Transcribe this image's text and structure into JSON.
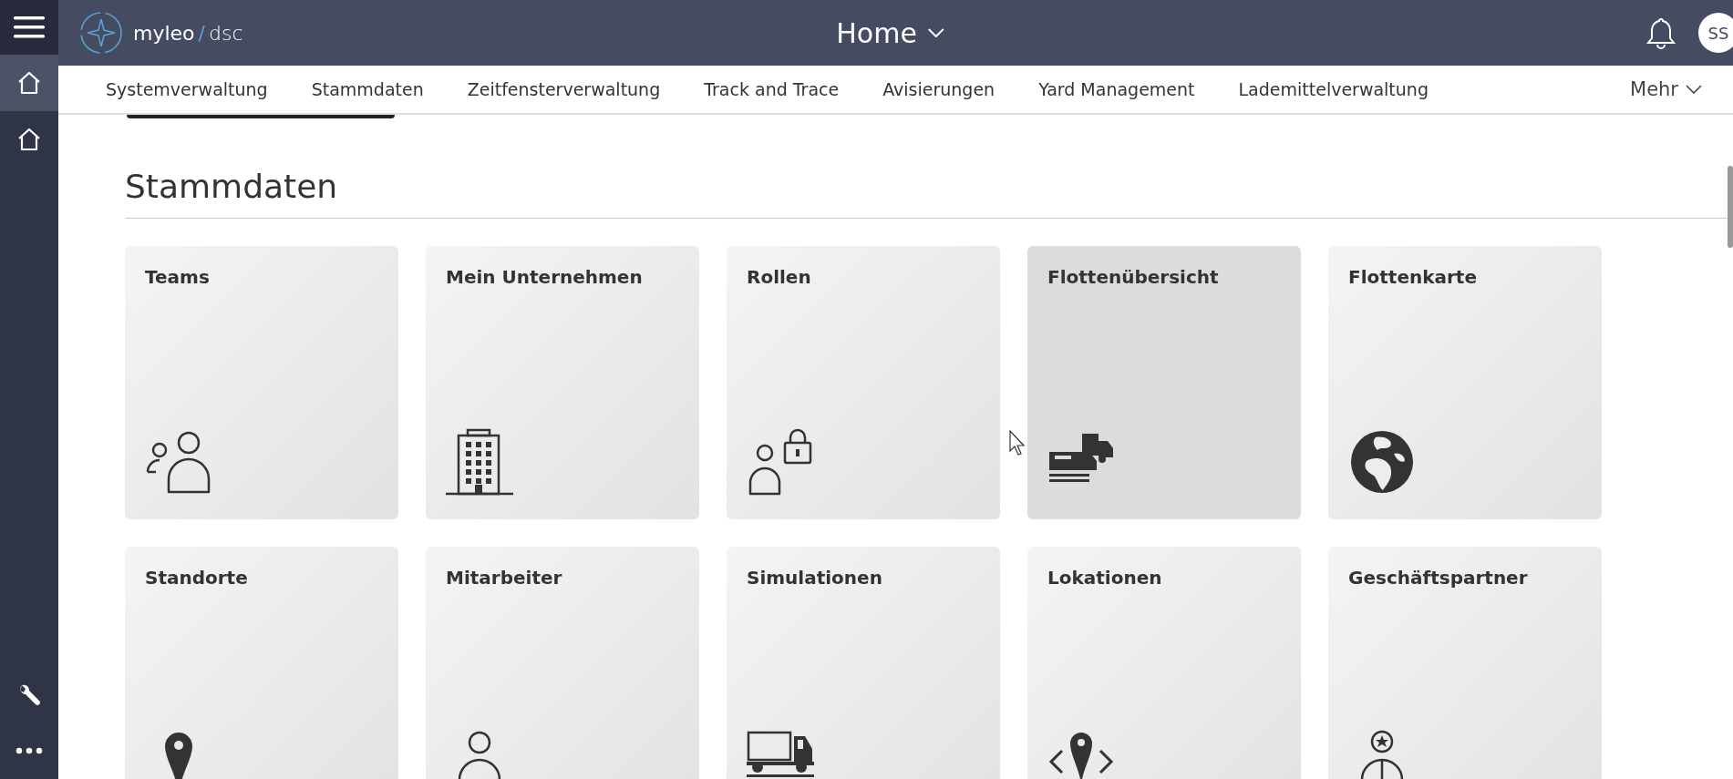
{
  "header": {
    "logo_text": "myleo",
    "logo_separator": "/",
    "logo_suffix": "dsc",
    "title": "Home",
    "avatar": "SS"
  },
  "sidebar": {
    "items": [
      {
        "kind": "home",
        "selected": true
      },
      {
        "kind": "home",
        "selected": false
      },
      {
        "kind": "tools",
        "selected": false
      },
      {
        "kind": "more",
        "selected": false
      }
    ]
  },
  "nav": {
    "items": [
      {
        "label": "Systemverwaltung",
        "selected": false
      },
      {
        "label": "Stammdaten",
        "selected": false
      },
      {
        "label": "Zeitfensterverwaltung",
        "selected": false
      },
      {
        "label": "Track and Trace",
        "selected": false
      },
      {
        "label": "Avisierungen",
        "selected": false
      },
      {
        "label": "Yard Management",
        "selected": false
      },
      {
        "label": "Lademittelverwaltung",
        "selected": false
      }
    ],
    "more": "Mehr"
  },
  "section": {
    "title": "Stammdaten"
  },
  "tiles": [
    {
      "title": "Teams",
      "kind": "people",
      "hovered": false
    },
    {
      "title": "Mein Unternehmen",
      "kind": "building",
      "hovered": false
    },
    {
      "title": "Rollen",
      "kind": "role",
      "hovered": false
    },
    {
      "title": "Flottenübersicht",
      "kind": "fleet",
      "hovered": true
    },
    {
      "title": "Flottenkarte",
      "kind": "globe",
      "hovered": false
    },
    {
      "title": "Standorte",
      "kind": "pin",
      "hovered": false
    },
    {
      "title": "Mitarbeiter",
      "kind": "person",
      "hovered": false
    },
    {
      "title": "Simulationen",
      "kind": "truck",
      "hovered": false
    },
    {
      "title": "Lokationen",
      "kind": "location",
      "hovered": false
    },
    {
      "title": "Geschäftspartner",
      "kind": "partner",
      "hovered": false
    }
  ]
}
